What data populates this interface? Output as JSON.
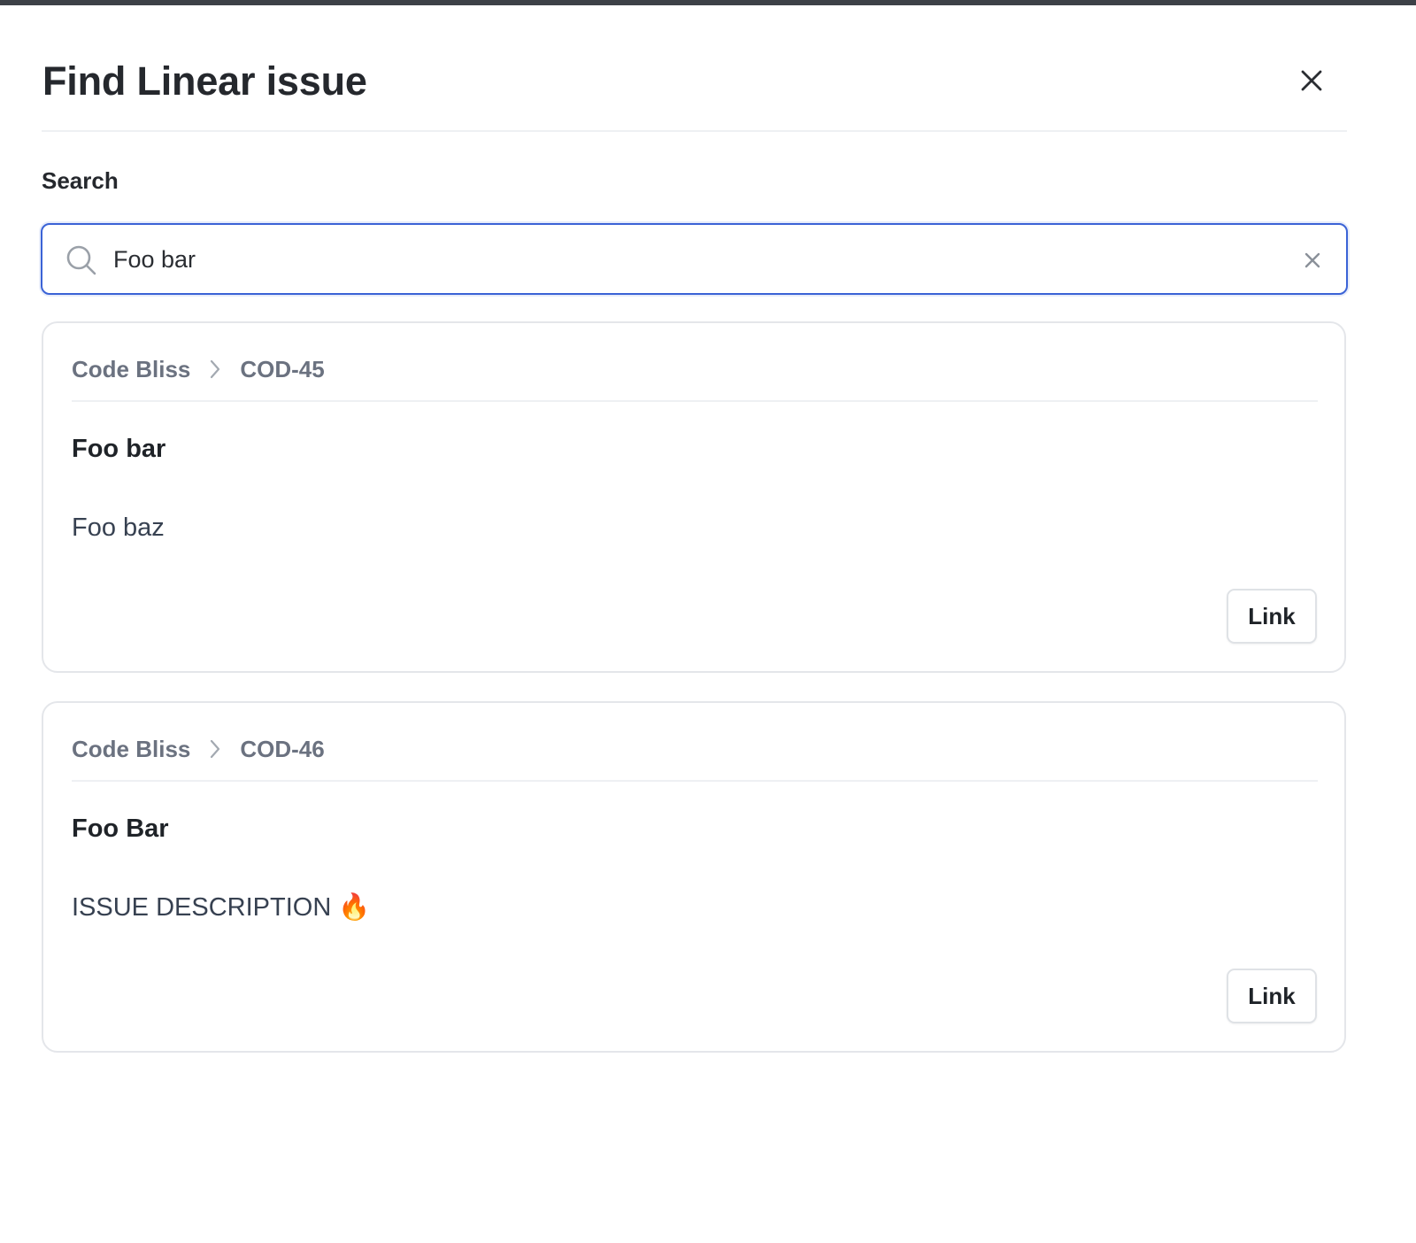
{
  "modal": {
    "title": "Find Linear issue",
    "close_icon": "close-icon"
  },
  "search": {
    "label": "Search",
    "value": "Foo bar",
    "placeholder": "",
    "search_icon": "search-icon",
    "clear_icon": "clear-icon",
    "focus_color": "#3b63d6"
  },
  "results": [
    {
      "team": "Code Bliss",
      "separator_icon": "chevron-right-icon",
      "identifier": "COD-45",
      "title": "Foo bar",
      "description": "Foo baz",
      "action_label": "Link"
    },
    {
      "team": "Code Bliss",
      "separator_icon": "chevron-right-icon",
      "identifier": "COD-46",
      "title": "Foo Bar",
      "description": "ISSUE DESCRIPTION 🔥",
      "action_label": "Link"
    }
  ]
}
